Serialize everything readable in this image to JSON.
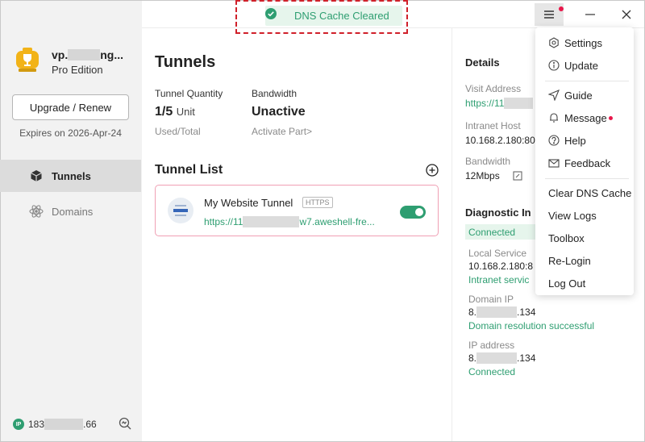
{
  "toast": {
    "text": "DNS Cache Cleared"
  },
  "sidebar": {
    "user_name_prefix": "vp.",
    "user_name_suffix": "ng...",
    "edition": "Pro Edition",
    "upgrade_label": "Upgrade / Renew",
    "expires": "Expires on 2026-Apr-24",
    "nav": [
      {
        "label": "Tunnels",
        "icon": "cube-icon",
        "active": true
      },
      {
        "label": "Domains",
        "icon": "atom-icon",
        "active": false
      }
    ],
    "ip_badge": "IP",
    "ip_prefix": "183",
    "ip_suffix": ".66"
  },
  "main": {
    "title": "Tunnels",
    "stats": {
      "quantity_label": "Tunnel Quantity",
      "quantity_value": "1/5",
      "quantity_unit": "Unit",
      "quantity_sub": "Used/Total",
      "bandwidth_label": "Bandwidth",
      "bandwidth_value": "Unactive",
      "bandwidth_sub": "Activate Part>"
    },
    "list_title": "Tunnel List",
    "tunnel": {
      "name": "My Website Tunnel",
      "badge": "HTTPS",
      "url_prefix": "https://11",
      "url_suffix": "w7.aweshell-fre...",
      "enabled": true
    }
  },
  "details": {
    "title": "Details",
    "visit_label": "Visit Address",
    "visit_prefix": "https://11",
    "intranet_label": "Intranet Host",
    "intranet_value": "10.168.2.180:80",
    "bandwidth_label": "Bandwidth",
    "bandwidth_value": "12Mbps",
    "diagnostic_title": "Diagnostic In",
    "diag_status": "Connected",
    "local_label": "Local Service",
    "local_value": "10.168.2.180:8",
    "local_status": "Intranet servic",
    "domain_ip_label": "Domain IP",
    "domain_ip_prefix": "8.",
    "domain_ip_suffix": ".134",
    "domain_status": "Domain resolution successful",
    "ip_label": "IP address",
    "ip_prefix": "8.",
    "ip_suffix": ".134",
    "ip_status": "Connected"
  },
  "menu": {
    "items": [
      {
        "label": "Settings",
        "icon": "settings-icon"
      },
      {
        "label": "Update",
        "icon": "info-icon"
      },
      {
        "label": "Guide",
        "icon": "send-icon"
      },
      {
        "label": "Message",
        "icon": "bell-icon",
        "dot": true
      },
      {
        "label": "Help",
        "icon": "help-icon"
      },
      {
        "label": "Feedback",
        "icon": "mail-icon"
      },
      {
        "label": "Clear DNS Cache"
      },
      {
        "label": "View Logs"
      },
      {
        "label": "Toolbox"
      },
      {
        "label": "Re-Login"
      },
      {
        "label": "Log Out"
      }
    ]
  },
  "colors": {
    "accent": "#2e9e71",
    "badge_dot": "#e8174a",
    "highlight_border": "#d0202a",
    "card_border": "#f0a0b4"
  }
}
